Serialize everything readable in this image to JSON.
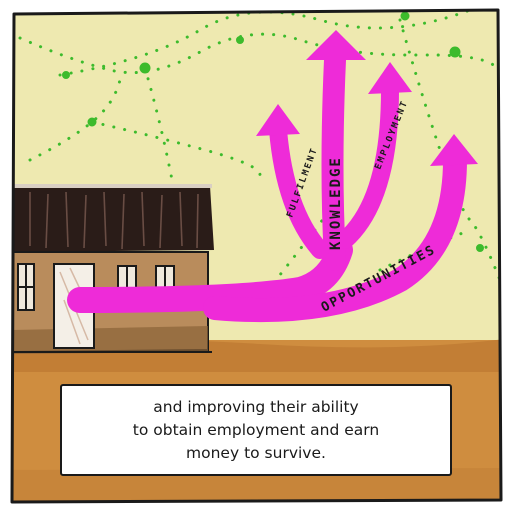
{
  "colors": {
    "sky": "#f1ecb5",
    "ground": "#cf8d3f",
    "arrow": "#ee2bd8",
    "dots": "#3dbb2c",
    "house_wall": "#b98c5c",
    "roof": "#2a1c18",
    "ink": "#1a1a1a"
  },
  "arrows": {
    "fulfilment": "FULFILMENT",
    "knowledge": "KNOWLEDGE",
    "employment": "EMPLOYMENT",
    "opportunities": "OPPORTUNITIES"
  },
  "caption": {
    "line1": "and improving their ability",
    "line2": "to obtain employment and earn",
    "line3": "money to survive."
  },
  "icons": [
    "house-illustration",
    "growth-arrows",
    "network-dots"
  ]
}
